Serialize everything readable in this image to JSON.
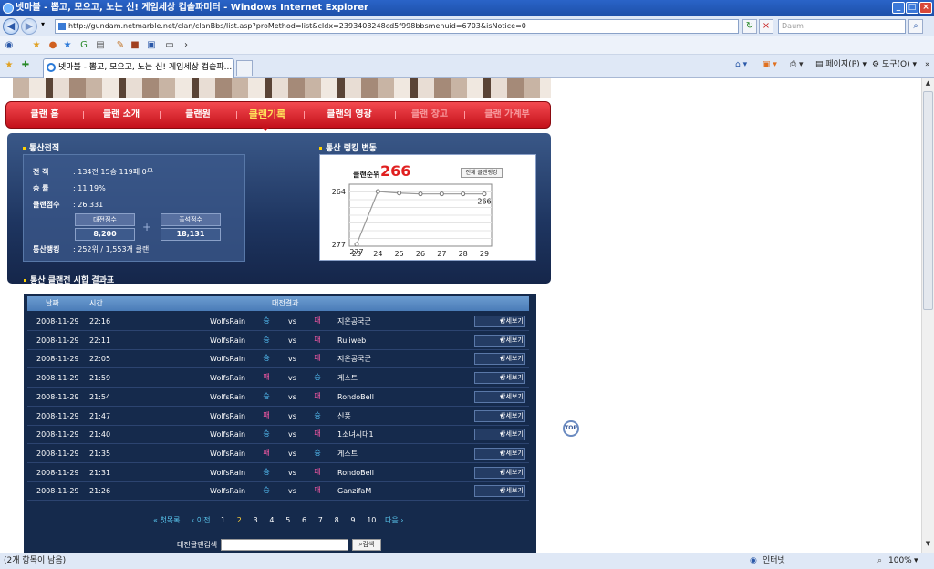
{
  "window": {
    "title": "넷마블 - 뽑고, 모으고, 노는 신! 게임세상 컵솥파미터 - Windows Internet Explorer"
  },
  "address": {
    "url": "http://gundam.netmarble.net/clan/clanBbs/list.asp?proMethod=list&cIdx=2393408248cd5f998bbsmenuid=6703&isNotice=0",
    "search_placeholder": "Daum"
  },
  "tab": {
    "label": "넷마블 - 뽑고, 모으고, 노는 신! 게임세상 컵솥파..."
  },
  "tools": {
    "page": "페이지(P)",
    "tools": "도구(O)"
  },
  "clan_nav": [
    {
      "label": "클랜 홈"
    },
    {
      "label": "클랜 소개"
    },
    {
      "label": "클랜원"
    },
    {
      "label": "클랜기록"
    },
    {
      "label": "클랜의 영광"
    },
    {
      "label": "클랜 창고"
    },
    {
      "label": "클랜 가계부"
    }
  ],
  "stats": {
    "section_title": "통산전적",
    "record_label": "전 적",
    "record_value": ": 134전 15승 119패 0무",
    "winrate_label": "승 률",
    "winrate_value": ": 11.19%",
    "points_label": "클랜점수",
    "points_value": ": 26,331",
    "battle_points_label": "대전점수",
    "battle_points_value": "8,200",
    "attend_points_label": "출석점수",
    "attend_points_value": "18,131",
    "plus": "+",
    "ranking_label": "통산랭킹",
    "ranking_value": ": 252위 / 1,553개 클랜"
  },
  "ranking_change": {
    "section_title": "통산 랭킹 변동",
    "rank_label": "클랜순위",
    "rank_value": "266",
    "all_rank_button": "전체 클랜랭킹"
  },
  "chart_data": {
    "type": "line",
    "x": [
      "23",
      "24",
      "25",
      "26",
      "27",
      "28",
      "29"
    ],
    "series": [
      {
        "values": [
          277,
          264,
          264.4,
          264.6,
          264.6,
          264.6,
          264.6
        ]
      }
    ],
    "yticks": [
      "264",
      "277"
    ],
    "ylim": [
      277,
      264
    ],
    "annotations": [
      "277",
      "266"
    ],
    "grid": true
  },
  "results": {
    "section_title": "통산 클랜전 시합 결과표",
    "headers": {
      "date": "날짜",
      "time": "시간",
      "result": "대전결과"
    },
    "vs": "vs",
    "detail_label": "상세보기",
    "rows": [
      {
        "date": "2008-11-29",
        "time": "22:16",
        "team": "WolfsRain",
        "left": "승",
        "right": "패",
        "opponent": "지온공국군"
      },
      {
        "date": "2008-11-29",
        "time": "22:11",
        "team": "WolfsRain",
        "left": "승",
        "right": "패",
        "opponent": "Ruliweb"
      },
      {
        "date": "2008-11-29",
        "time": "22:05",
        "team": "WolfsRain",
        "left": "승",
        "right": "패",
        "opponent": "지온공국군"
      },
      {
        "date": "2008-11-29",
        "time": "21:59",
        "team": "WolfsRain",
        "left": "패",
        "right": "승",
        "opponent": "게스트"
      },
      {
        "date": "2008-11-29",
        "time": "21:54",
        "team": "WolfsRain",
        "left": "승",
        "right": "패",
        "opponent": "RondoBell"
      },
      {
        "date": "2008-11-29",
        "time": "21:47",
        "team": "WolfsRain",
        "left": "패",
        "right": "승",
        "opponent": "신풍"
      },
      {
        "date": "2008-11-29",
        "time": "21:40",
        "team": "WolfsRain",
        "left": "승",
        "right": "패",
        "opponent": "1소녀시대1"
      },
      {
        "date": "2008-11-29",
        "time": "21:35",
        "team": "WolfsRain",
        "left": "패",
        "right": "승",
        "opponent": "게스트"
      },
      {
        "date": "2008-11-29",
        "time": "21:31",
        "team": "WolfsRain",
        "left": "승",
        "right": "패",
        "opponent": "RondoBell"
      },
      {
        "date": "2008-11-29",
        "time": "21:26",
        "team": "WolfsRain",
        "left": "승",
        "right": "패",
        "opponent": "GanzifaM"
      }
    ]
  },
  "pager": {
    "first": "« 첫목록",
    "prev": "‹ 이전",
    "pages": [
      "1",
      "2",
      "3",
      "4",
      "5",
      "6",
      "7",
      "8",
      "9",
      "10"
    ],
    "current": "2",
    "next": "다음 ›"
  },
  "clan_search": {
    "label": "대전클랜검색",
    "button": "검색"
  },
  "top_button": "TOP",
  "status": {
    "left": "(2개 항목이 남음)",
    "zone": "인터넷",
    "zoom": "100%"
  },
  "colors": {
    "nav_red": "#d82028",
    "active_nav": "#ffe25a",
    "panel_navy": "#1e3560",
    "rank_red": "#e02020"
  }
}
